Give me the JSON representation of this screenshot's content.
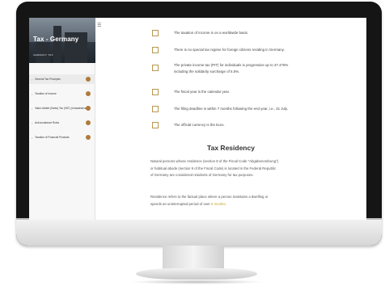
{
  "sidebar": {
    "title": "Tax - Germany",
    "subtitle": "GERMANY TAX",
    "items": [
      {
        "label": "General Tax Principles"
      },
      {
        "label": "Taxation of Income"
      },
      {
        "label": "Value-Added (Sales) Tax (VAT) (Umsatzsteuer)"
      },
      {
        "label": "Anti-avoidance Rules"
      },
      {
        "label": "Taxation of Financial Products"
      }
    ]
  },
  "main": {
    "checklist": [
      {
        "text": "The taxation of income is on a worldwide basis."
      },
      {
        "text": "There is no special tax regime for foreign citizens residing in Germany."
      },
      {
        "text": "The private income tax (PIT) for individuals is progressive up to 47.475%",
        "text2": "including the solidarity surcharge of 5.5%."
      },
      {
        "text": "The fiscal year is the calendar year."
      },
      {
        "text": "The filing deadline is within 7 months following the end year, i.e., 31 July."
      },
      {
        "text": "The official currency is the Euro."
      }
    ],
    "section_title": "Tax Residency",
    "para1": {
      "line1": "Natural persons whose residence (section 8 of the Fiscal Code \"Abgabenordnung\")",
      "line2": "or habitual abode (section 9 of the Fiscal Code) is located in the Federal Republic",
      "line3": "of Germany are considered residents of Germany for tax purposes."
    },
    "para2": {
      "line1": "Residence refers to the factual place where a person maintains a dwelling or",
      "line2_prefix": "spends an uninterrupted period of over ",
      "line2_highlight": "6 months",
      "line2_suffix": "."
    }
  },
  "colors": {
    "accent": "#b9964f",
    "highlight": "#c9a32a",
    "nav_dot": "#b07a3a"
  }
}
